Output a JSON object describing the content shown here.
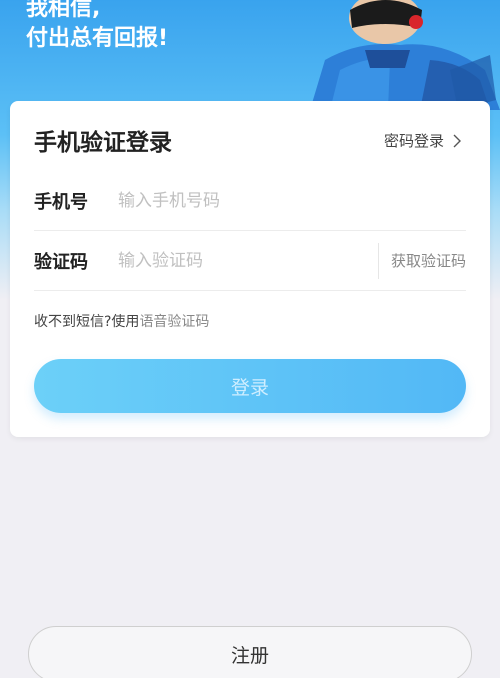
{
  "hero": {
    "slogan_line1": "我相信,",
    "slogan_line2": "付出总有回报!"
  },
  "card": {
    "title": "手机验证登录",
    "password_login_label": "密码登录"
  },
  "phone_row": {
    "label": "手机号",
    "placeholder": "输入手机号码",
    "value": ""
  },
  "code_row": {
    "label": "验证码",
    "placeholder": "输入验证码",
    "value": "",
    "get_code_label": "获取验证码"
  },
  "voice": {
    "hint": "收不到短信?使用",
    "link": "语音验证码"
  },
  "login_button": "登录",
  "register_button": "注册",
  "colors": {
    "accent": "#52b8f6",
    "hero_top": "#39a3ee"
  }
}
